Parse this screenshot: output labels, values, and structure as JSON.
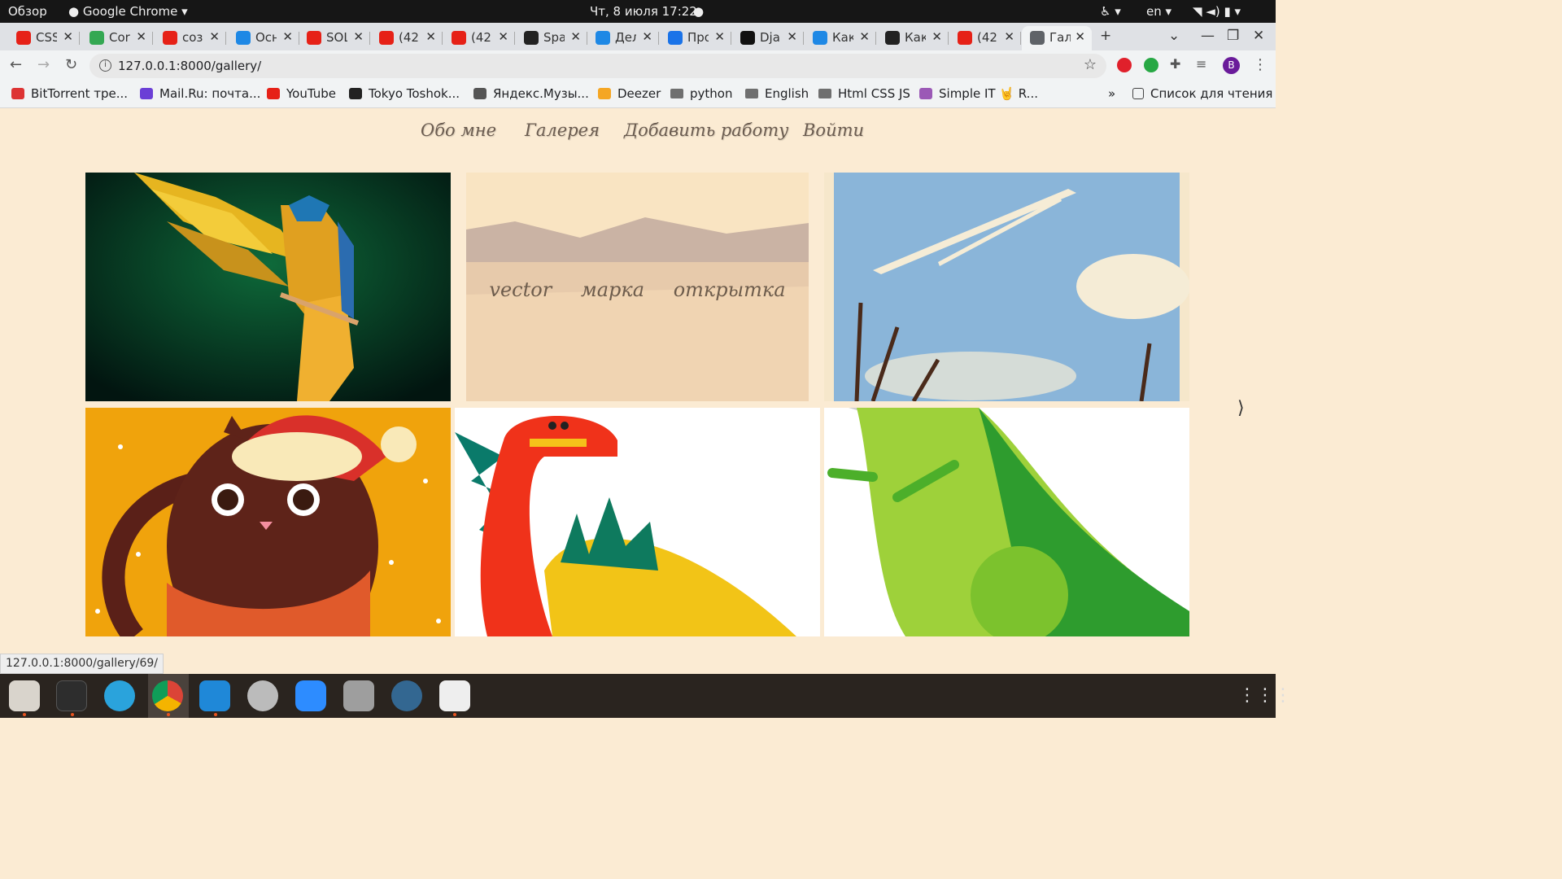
{
  "os": {
    "activities": "Обзор",
    "app": "Google Chrome",
    "clock": "Чт, 8 июля  17:22",
    "lang": "en"
  },
  "tabs": [
    {
      "label": "CSS",
      "color": "#e62117",
      "active": false
    },
    {
      "label": "Cor",
      "color": "#34a853",
      "active": false
    },
    {
      "label": "соз",
      "color": "#e62117",
      "active": false
    },
    {
      "label": "Осн",
      "color": "#1e88e5",
      "active": false
    },
    {
      "label": "SOL",
      "color": "#e62117",
      "active": false
    },
    {
      "label": "(42",
      "color": "#e62117",
      "active": false
    },
    {
      "label": "(42",
      "color": "#e62117",
      "active": false
    },
    {
      "label": "Spa",
      "color": "#222222",
      "active": false
    },
    {
      "label": "Дел",
      "color": "#1e88e5",
      "active": false
    },
    {
      "label": "Про",
      "color": "#1a73e8",
      "active": false
    },
    {
      "label": "Dja",
      "color": "#111111",
      "active": false
    },
    {
      "label": "Как",
      "color": "#1e88e5",
      "active": false
    },
    {
      "label": "Как",
      "color": "#222222",
      "active": false
    },
    {
      "label": "(42",
      "color": "#e62117",
      "active": false
    },
    {
      "label": "Гал",
      "color": "#5f6368",
      "active": true
    }
  ],
  "address": {
    "url": "127.0.0.1:8000/gallery/"
  },
  "bookmarks": [
    {
      "label": "BitTorrent тре...",
      "color": "#d33"
    },
    {
      "label": "Mail.Ru: почта...",
      "color": "#6b3fd6"
    },
    {
      "label": "YouTube",
      "color": "#e62117"
    },
    {
      "label": "Tokyo Toshok...",
      "color": "#222"
    },
    {
      "label": "Яндекс.Музы...",
      "color": "#555"
    },
    {
      "label": "Deezer",
      "color": "#f5a623"
    },
    {
      "label": "python",
      "color": "folder"
    },
    {
      "label": "English",
      "color": "folder"
    },
    {
      "label": "Html CSS JS",
      "color": "folder"
    },
    {
      "label": "Simple IT 🤘 R...",
      "color": "#9b59b6"
    }
  ],
  "bookmarks_more": "»",
  "reading_list": "Список для чтения",
  "site_nav": [
    "Обо мне",
    "Галерея",
    "Добавить работу",
    "Войти"
  ],
  "gallery": {
    "hover_tags": [
      "vector",
      "марка",
      "открытка"
    ],
    "next_arrow": "⟩",
    "images": [
      "parrot",
      "landscape",
      "sky",
      "cat",
      "dragon",
      "dino"
    ]
  },
  "status_url": "127.0.0.1:8000/gallery/69/",
  "profile_letter": "B"
}
